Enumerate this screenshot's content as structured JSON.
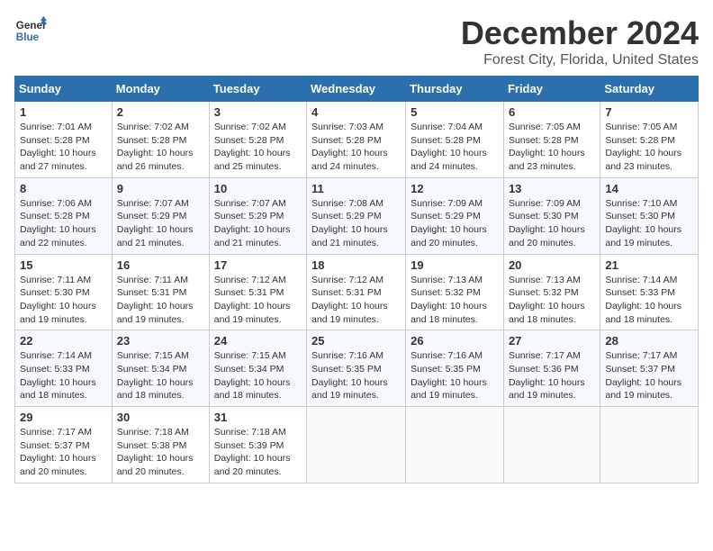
{
  "header": {
    "logo_line1": "General",
    "logo_line2": "Blue",
    "month": "December 2024",
    "location": "Forest City, Florida, United States"
  },
  "weekdays": [
    "Sunday",
    "Monday",
    "Tuesday",
    "Wednesday",
    "Thursday",
    "Friday",
    "Saturday"
  ],
  "weeks": [
    [
      {
        "day": "1",
        "sunrise": "7:01 AM",
        "sunset": "5:28 PM",
        "daylight": "10 hours and 27 minutes."
      },
      {
        "day": "2",
        "sunrise": "7:02 AM",
        "sunset": "5:28 PM",
        "daylight": "10 hours and 26 minutes."
      },
      {
        "day": "3",
        "sunrise": "7:02 AM",
        "sunset": "5:28 PM",
        "daylight": "10 hours and 25 minutes."
      },
      {
        "day": "4",
        "sunrise": "7:03 AM",
        "sunset": "5:28 PM",
        "daylight": "10 hours and 24 minutes."
      },
      {
        "day": "5",
        "sunrise": "7:04 AM",
        "sunset": "5:28 PM",
        "daylight": "10 hours and 24 minutes."
      },
      {
        "day": "6",
        "sunrise": "7:05 AM",
        "sunset": "5:28 PM",
        "daylight": "10 hours and 23 minutes."
      },
      {
        "day": "7",
        "sunrise": "7:05 AM",
        "sunset": "5:28 PM",
        "daylight": "10 hours and 23 minutes."
      }
    ],
    [
      {
        "day": "8",
        "sunrise": "7:06 AM",
        "sunset": "5:28 PM",
        "daylight": "10 hours and 22 minutes."
      },
      {
        "day": "9",
        "sunrise": "7:07 AM",
        "sunset": "5:29 PM",
        "daylight": "10 hours and 21 minutes."
      },
      {
        "day": "10",
        "sunrise": "7:07 AM",
        "sunset": "5:29 PM",
        "daylight": "10 hours and 21 minutes."
      },
      {
        "day": "11",
        "sunrise": "7:08 AM",
        "sunset": "5:29 PM",
        "daylight": "10 hours and 21 minutes."
      },
      {
        "day": "12",
        "sunrise": "7:09 AM",
        "sunset": "5:29 PM",
        "daylight": "10 hours and 20 minutes."
      },
      {
        "day": "13",
        "sunrise": "7:09 AM",
        "sunset": "5:30 PM",
        "daylight": "10 hours and 20 minutes."
      },
      {
        "day": "14",
        "sunrise": "7:10 AM",
        "sunset": "5:30 PM",
        "daylight": "10 hours and 19 minutes."
      }
    ],
    [
      {
        "day": "15",
        "sunrise": "7:11 AM",
        "sunset": "5:30 PM",
        "daylight": "10 hours and 19 minutes."
      },
      {
        "day": "16",
        "sunrise": "7:11 AM",
        "sunset": "5:31 PM",
        "daylight": "10 hours and 19 minutes."
      },
      {
        "day": "17",
        "sunrise": "7:12 AM",
        "sunset": "5:31 PM",
        "daylight": "10 hours and 19 minutes."
      },
      {
        "day": "18",
        "sunrise": "7:12 AM",
        "sunset": "5:31 PM",
        "daylight": "10 hours and 19 minutes."
      },
      {
        "day": "19",
        "sunrise": "7:13 AM",
        "sunset": "5:32 PM",
        "daylight": "10 hours and 18 minutes."
      },
      {
        "day": "20",
        "sunrise": "7:13 AM",
        "sunset": "5:32 PM",
        "daylight": "10 hours and 18 minutes."
      },
      {
        "day": "21",
        "sunrise": "7:14 AM",
        "sunset": "5:33 PM",
        "daylight": "10 hours and 18 minutes."
      }
    ],
    [
      {
        "day": "22",
        "sunrise": "7:14 AM",
        "sunset": "5:33 PM",
        "daylight": "10 hours and 18 minutes."
      },
      {
        "day": "23",
        "sunrise": "7:15 AM",
        "sunset": "5:34 PM",
        "daylight": "10 hours and 18 minutes."
      },
      {
        "day": "24",
        "sunrise": "7:15 AM",
        "sunset": "5:34 PM",
        "daylight": "10 hours and 18 minutes."
      },
      {
        "day": "25",
        "sunrise": "7:16 AM",
        "sunset": "5:35 PM",
        "daylight": "10 hours and 19 minutes."
      },
      {
        "day": "26",
        "sunrise": "7:16 AM",
        "sunset": "5:35 PM",
        "daylight": "10 hours and 19 minutes."
      },
      {
        "day": "27",
        "sunrise": "7:17 AM",
        "sunset": "5:36 PM",
        "daylight": "10 hours and 19 minutes."
      },
      {
        "day": "28",
        "sunrise": "7:17 AM",
        "sunset": "5:37 PM",
        "daylight": "10 hours and 19 minutes."
      }
    ],
    [
      {
        "day": "29",
        "sunrise": "7:17 AM",
        "sunset": "5:37 PM",
        "daylight": "10 hours and 20 minutes."
      },
      {
        "day": "30",
        "sunrise": "7:18 AM",
        "sunset": "5:38 PM",
        "daylight": "10 hours and 20 minutes."
      },
      {
        "day": "31",
        "sunrise": "7:18 AM",
        "sunset": "5:39 PM",
        "daylight": "10 hours and 20 minutes."
      },
      null,
      null,
      null,
      null
    ]
  ]
}
